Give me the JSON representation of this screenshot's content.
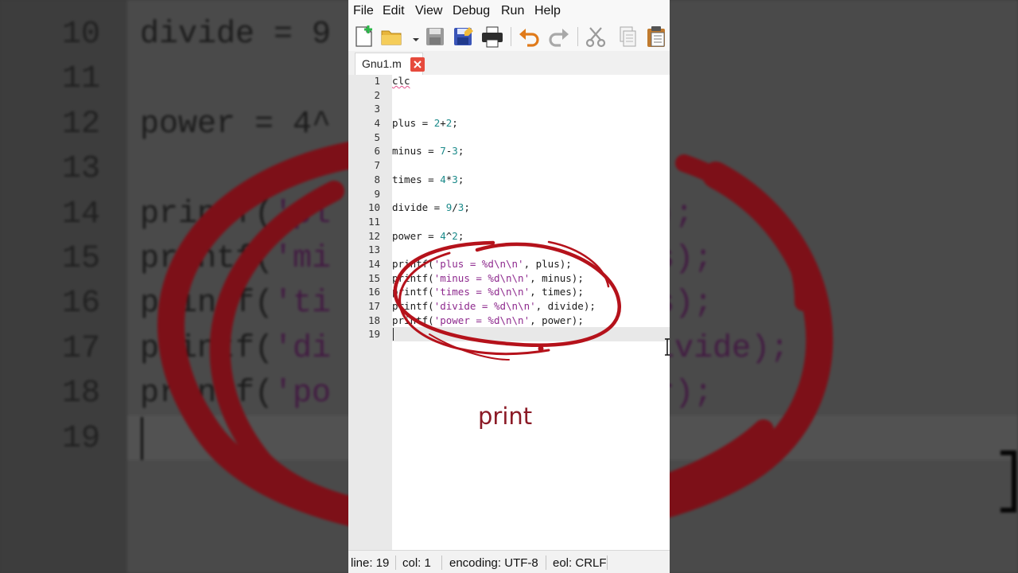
{
  "menu": [
    "File",
    "Edit",
    "View",
    "Debug",
    "Run",
    "Help"
  ],
  "tab": {
    "filename": "Gnu1.m"
  },
  "code_lines": [
    "clc",
    "",
    "",
    "plus = 2+2;",
    "",
    "minus = 7-3;",
    "",
    "times = 4*3;",
    "",
    "divide = 9/3;",
    "",
    "power = 4^2;",
    "",
    "printf('plus = %d\\n\\n', plus);",
    "printf('minus = %d\\n\\n', minus);",
    "printf('times = %d\\n\\n', times);",
    "printf('divide = %d\\n\\n', divide);",
    "printf('power = %d\\n\\n', power);",
    ""
  ],
  "status": {
    "line_label": "line:",
    "line_value": "19",
    "col_label": "col:",
    "col_value": "1",
    "encoding_label": "encoding:",
    "encoding_value": "UTF-8",
    "eol_label": "eol:",
    "eol_value": "CRLF"
  },
  "annotation": {
    "label": "print",
    "color": "#b5121b"
  },
  "background_zoom": {
    "lines": [
      {
        "num": "10",
        "code": "divide = 9"
      },
      {
        "num": "11",
        "code": ""
      },
      {
        "num": "12",
        "code": "power = 4^"
      },
      {
        "num": "13",
        "code": ""
      },
      {
        "num": "14",
        "code": "printf('pl             plus);"
      },
      {
        "num": "15",
        "code": "printf('mi             minus);"
      },
      {
        "num": "16",
        "code": "printf('ti             times);"
      },
      {
        "num": "17",
        "code": "printf('di              , divide);"
      },
      {
        "num": "18",
        "code": "printf('po             power);"
      },
      {
        "num": "19",
        "code": ""
      }
    ]
  }
}
